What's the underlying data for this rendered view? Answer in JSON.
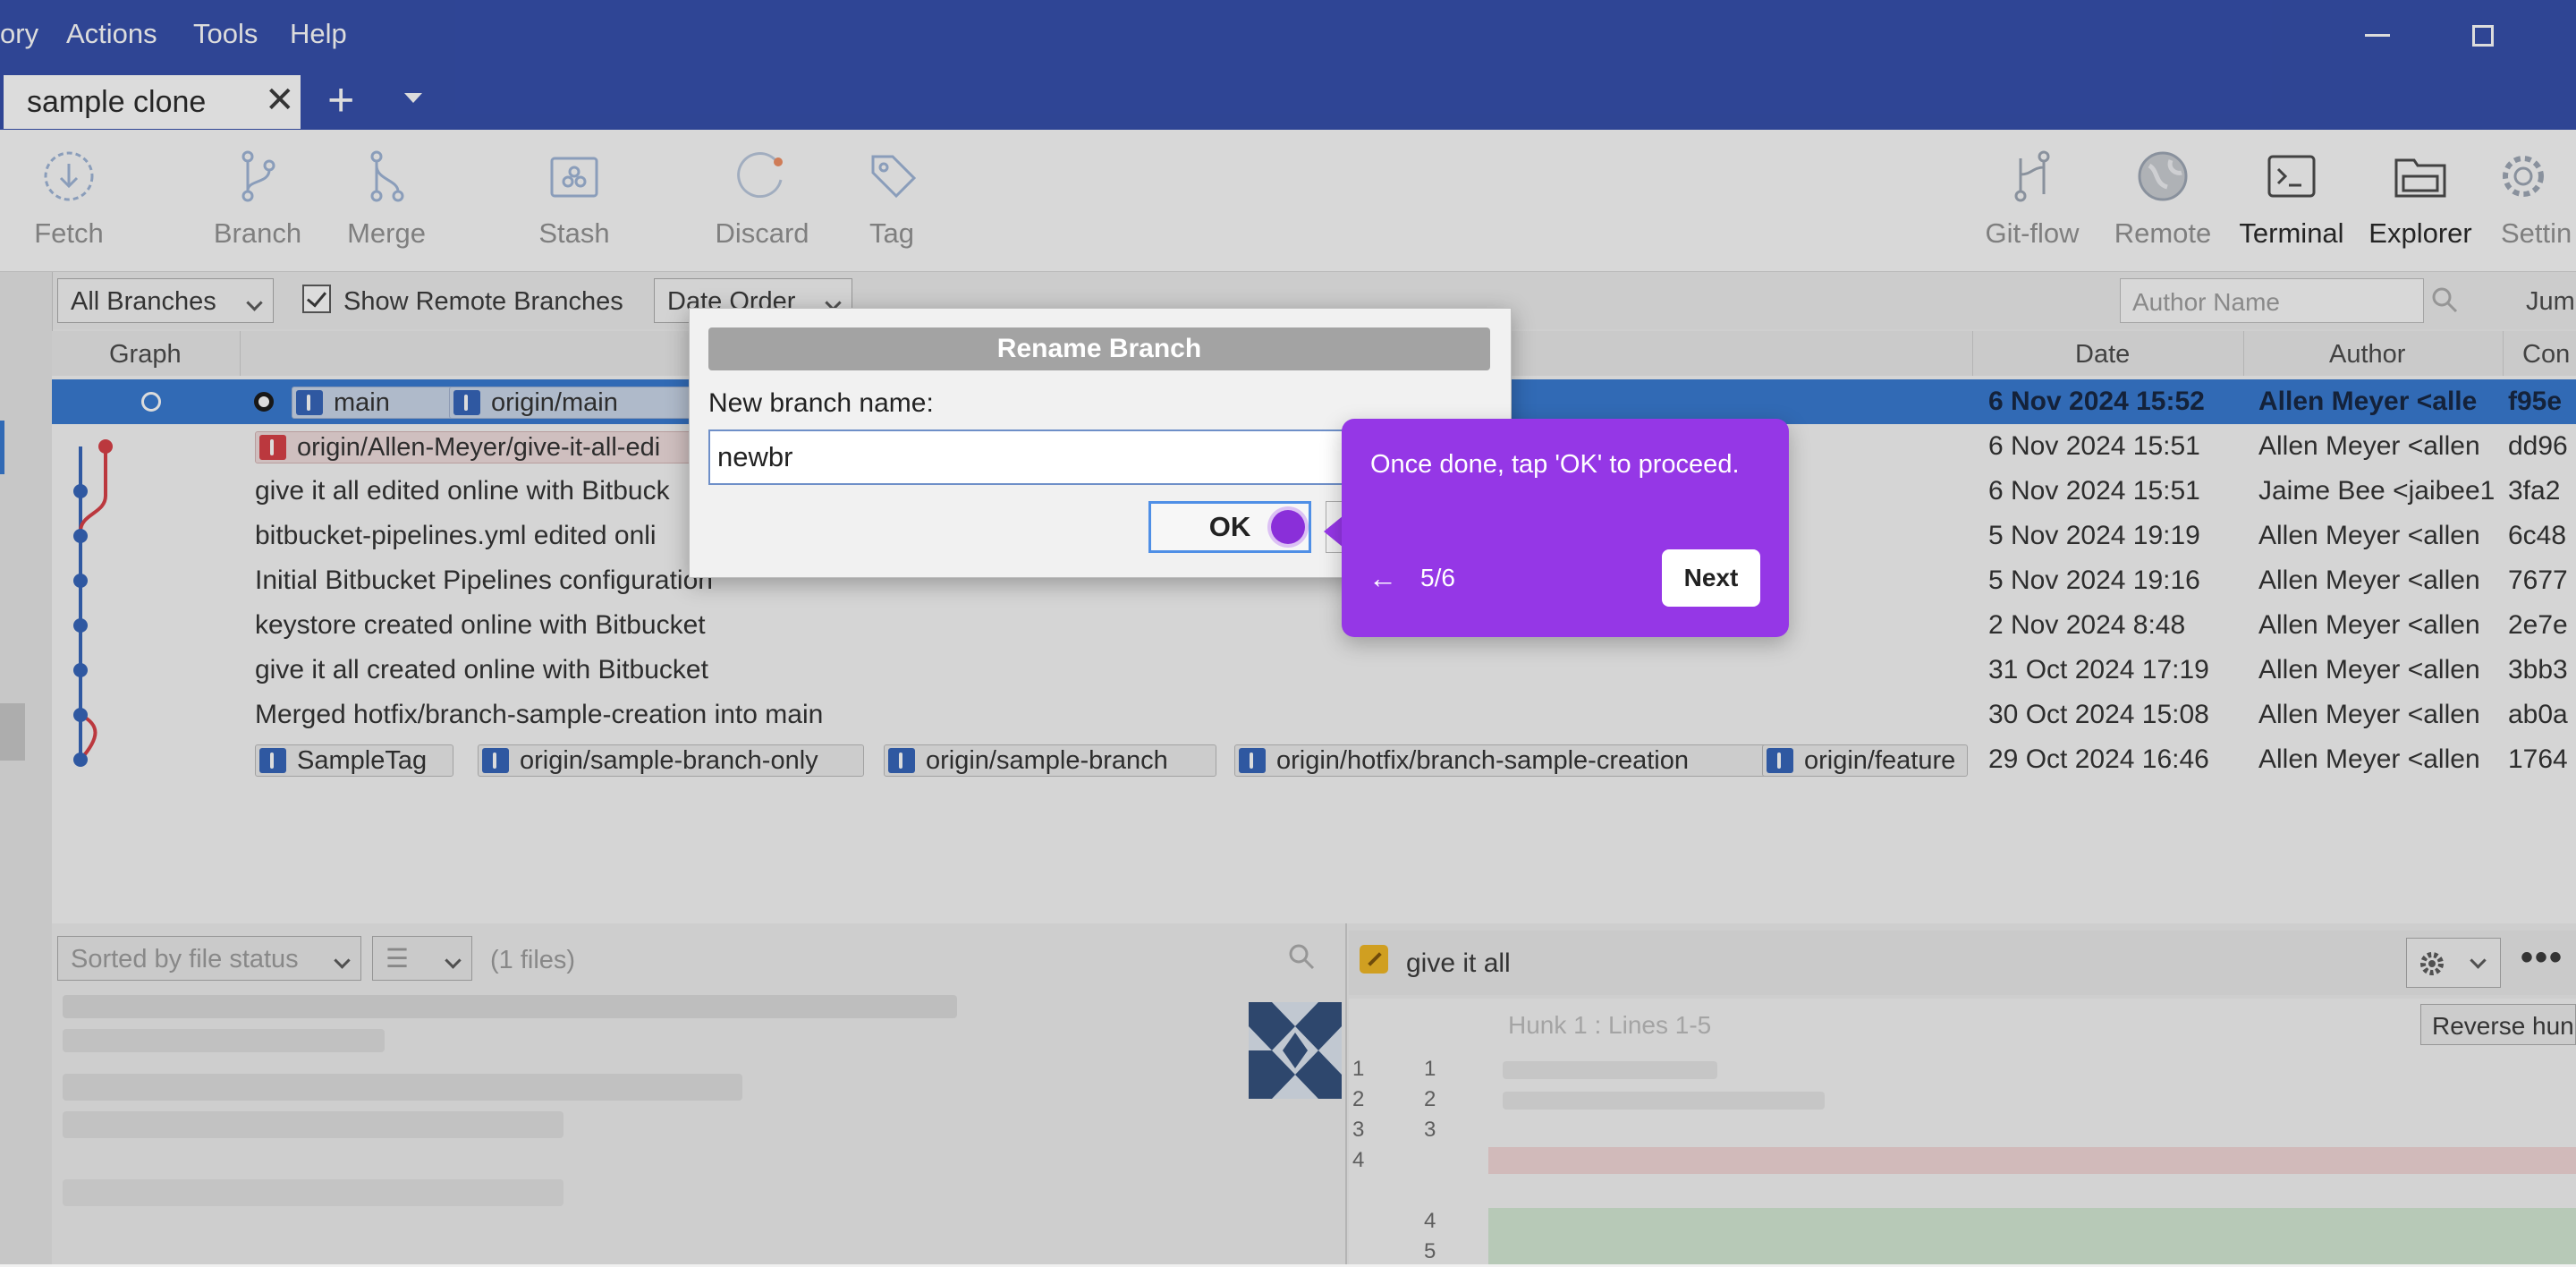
{
  "menu": [
    "ory",
    "Actions",
    "Tools",
    "Help"
  ],
  "window": {
    "minimize": "—",
    "maximize": "☐"
  },
  "tab": {
    "label": "sample clone",
    "close": "✕",
    "add": "+"
  },
  "toolbar": {
    "left": [
      "Fetch",
      "Branch",
      "Merge",
      "Stash",
      "Discard",
      "Tag"
    ],
    "right": [
      "Git-flow",
      "Remote",
      "Terminal",
      "Explorer",
      "Settin"
    ]
  },
  "filters": {
    "branches": "All Branches",
    "show_remote": "Show Remote Branches",
    "order": "Date Order",
    "author_placeholder": "Author Name",
    "jump": "Jum"
  },
  "columns": {
    "graph": "Graph",
    "date": "Date",
    "author": "Author",
    "commit": "Con"
  },
  "commits": [
    {
      "refs": [
        "main",
        "origin/main"
      ],
      "message": "",
      "date": "6 Nov 2024 15:52",
      "author": "Allen Meyer <alle",
      "hash": "f95e",
      "selected": true
    },
    {
      "refs": [
        "origin/Allen-Meyer/give-it-all-edi"
      ],
      "message": "",
      "date": "6 Nov 2024 15:51",
      "author": "Allen Meyer <allen",
      "hash": "dd96"
    },
    {
      "refs": [],
      "message": "give it all edited online with Bitbuck",
      "date": "6 Nov 2024 15:51",
      "author": "Jaime Bee <jaibee1",
      "hash": "3fa2"
    },
    {
      "refs": [],
      "message": "bitbucket-pipelines.yml edited onli",
      "date": "5 Nov 2024 19:19",
      "author": "Allen Meyer <allen",
      "hash": "6c48"
    },
    {
      "refs": [],
      "message": "Initial Bitbucket Pipelines configuration",
      "date": "5 Nov 2024 19:16",
      "author": "Allen Meyer <allen",
      "hash": "7677"
    },
    {
      "refs": [],
      "message": "keystore created online with Bitbucket",
      "date": "2 Nov 2024 8:48",
      "author": "Allen Meyer <allen",
      "hash": "2e7e"
    },
    {
      "refs": [],
      "message": "give it all created online with Bitbucket",
      "date": "31 Oct 2024 17:19",
      "author": "Allen Meyer <allen",
      "hash": "3bb3"
    },
    {
      "refs": [],
      "message": "Merged hotfix/branch-sample-creation into main",
      "date": "30 Oct 2024 15:08",
      "author": "Allen Meyer <allen",
      "hash": "ab0a"
    },
    {
      "refs": [
        "SampleTag",
        "origin/sample-branch-only",
        "origin/sample-branch",
        "origin/hotfix/branch-sample-creation",
        "origin/feature"
      ],
      "message": "",
      "date": "29 Oct 2024 16:46",
      "author": "Allen Meyer <allen",
      "hash": "1764"
    }
  ],
  "files_panel": {
    "sort": "Sorted by file status",
    "count": "(1 files)"
  },
  "diff_panel": {
    "file": "give it all",
    "hunk": "Hunk 1 : Lines 1-5",
    "reverse": "Reverse hun",
    "line_numbers_old": [
      "1",
      "2",
      "3",
      "4"
    ],
    "line_numbers_new": [
      "1",
      "2",
      "3",
      "4",
      "5"
    ]
  },
  "dialog": {
    "title": "Rename Branch",
    "label": "New branch name:",
    "value": "newbr",
    "ok": "OK"
  },
  "tour": {
    "text": "Once done, tap 'OK' to proceed.",
    "step": "5/6",
    "next": "Next",
    "back": "←"
  },
  "colors": {
    "titlebar": "#2c47a8",
    "selection": "#2f74d0",
    "tour": "#9537e6"
  }
}
